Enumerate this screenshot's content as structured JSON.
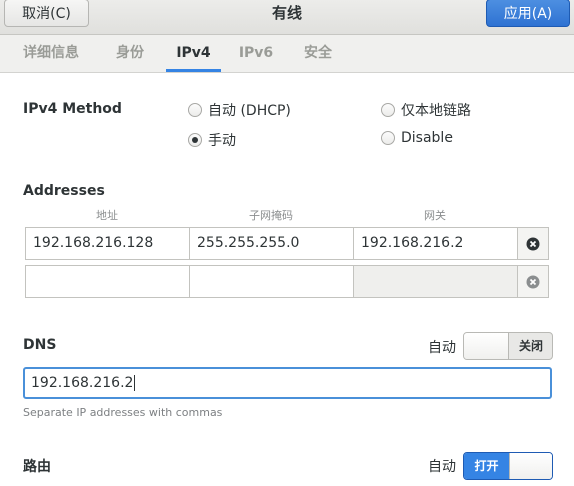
{
  "header": {
    "title": "有线",
    "cancel_label": "取消(C)",
    "apply_label": "应用(A)"
  },
  "tabs": [
    {
      "label": "详细信息",
      "active": false
    },
    {
      "label": "身份",
      "active": false
    },
    {
      "label": "IPv4",
      "active": true
    },
    {
      "label": "IPv6",
      "active": false
    },
    {
      "label": "安全",
      "active": false
    }
  ],
  "ipv4_method": {
    "label": "IPv4 Method",
    "options": [
      {
        "label": "自动 (DHCP)",
        "checked": false
      },
      {
        "label": "仅本地链路",
        "checked": false
      },
      {
        "label": "手动",
        "checked": true
      },
      {
        "label": "Disable",
        "checked": false
      }
    ]
  },
  "addresses": {
    "label": "Addresses",
    "columns": [
      "地址",
      "子网掩码",
      "网关"
    ],
    "rows": [
      [
        "192.168.216.128",
        "255.255.255.0",
        "192.168.216.2"
      ],
      [
        "",
        "",
        ""
      ]
    ]
  },
  "dns": {
    "label": "DNS",
    "auto_label": "自动",
    "toggle_state": "关闭",
    "value": "192.168.216.2",
    "hint": "Separate IP addresses with commas"
  },
  "routes": {
    "label": "路由",
    "auto_label": "自动",
    "toggle_state": "打开"
  },
  "colors": {
    "accent": "#3584e4",
    "toggle_on": "#3584e4"
  }
}
